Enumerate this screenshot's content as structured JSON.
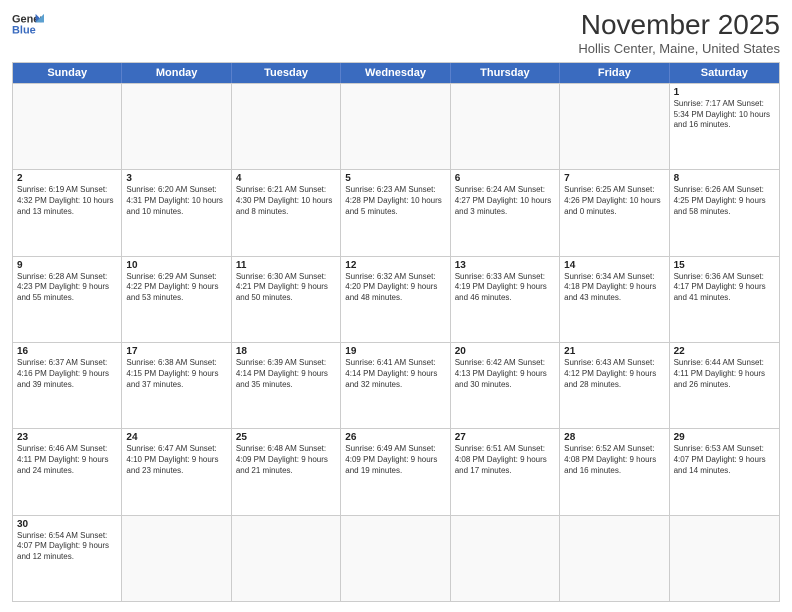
{
  "header": {
    "logo_line1": "General",
    "logo_line2": "Blue",
    "month_title": "November 2025",
    "location": "Hollis Center, Maine, United States"
  },
  "day_headers": [
    "Sunday",
    "Monday",
    "Tuesday",
    "Wednesday",
    "Thursday",
    "Friday",
    "Saturday"
  ],
  "weeks": [
    [
      {
        "day": "",
        "info": ""
      },
      {
        "day": "",
        "info": ""
      },
      {
        "day": "",
        "info": ""
      },
      {
        "day": "",
        "info": ""
      },
      {
        "day": "",
        "info": ""
      },
      {
        "day": "",
        "info": ""
      },
      {
        "day": "1",
        "info": "Sunrise: 7:17 AM\nSunset: 5:34 PM\nDaylight: 10 hours\nand 16 minutes."
      }
    ],
    [
      {
        "day": "2",
        "info": "Sunrise: 6:19 AM\nSunset: 4:32 PM\nDaylight: 10 hours\nand 13 minutes."
      },
      {
        "day": "3",
        "info": "Sunrise: 6:20 AM\nSunset: 4:31 PM\nDaylight: 10 hours\nand 10 minutes."
      },
      {
        "day": "4",
        "info": "Sunrise: 6:21 AM\nSunset: 4:30 PM\nDaylight: 10 hours\nand 8 minutes."
      },
      {
        "day": "5",
        "info": "Sunrise: 6:23 AM\nSunset: 4:28 PM\nDaylight: 10 hours\nand 5 minutes."
      },
      {
        "day": "6",
        "info": "Sunrise: 6:24 AM\nSunset: 4:27 PM\nDaylight: 10 hours\nand 3 minutes."
      },
      {
        "day": "7",
        "info": "Sunrise: 6:25 AM\nSunset: 4:26 PM\nDaylight: 10 hours\nand 0 minutes."
      },
      {
        "day": "8",
        "info": "Sunrise: 6:26 AM\nSunset: 4:25 PM\nDaylight: 9 hours\nand 58 minutes."
      }
    ],
    [
      {
        "day": "9",
        "info": "Sunrise: 6:28 AM\nSunset: 4:23 PM\nDaylight: 9 hours\nand 55 minutes."
      },
      {
        "day": "10",
        "info": "Sunrise: 6:29 AM\nSunset: 4:22 PM\nDaylight: 9 hours\nand 53 minutes."
      },
      {
        "day": "11",
        "info": "Sunrise: 6:30 AM\nSunset: 4:21 PM\nDaylight: 9 hours\nand 50 minutes."
      },
      {
        "day": "12",
        "info": "Sunrise: 6:32 AM\nSunset: 4:20 PM\nDaylight: 9 hours\nand 48 minutes."
      },
      {
        "day": "13",
        "info": "Sunrise: 6:33 AM\nSunset: 4:19 PM\nDaylight: 9 hours\nand 46 minutes."
      },
      {
        "day": "14",
        "info": "Sunrise: 6:34 AM\nSunset: 4:18 PM\nDaylight: 9 hours\nand 43 minutes."
      },
      {
        "day": "15",
        "info": "Sunrise: 6:36 AM\nSunset: 4:17 PM\nDaylight: 9 hours\nand 41 minutes."
      }
    ],
    [
      {
        "day": "16",
        "info": "Sunrise: 6:37 AM\nSunset: 4:16 PM\nDaylight: 9 hours\nand 39 minutes."
      },
      {
        "day": "17",
        "info": "Sunrise: 6:38 AM\nSunset: 4:15 PM\nDaylight: 9 hours\nand 37 minutes."
      },
      {
        "day": "18",
        "info": "Sunrise: 6:39 AM\nSunset: 4:14 PM\nDaylight: 9 hours\nand 35 minutes."
      },
      {
        "day": "19",
        "info": "Sunrise: 6:41 AM\nSunset: 4:14 PM\nDaylight: 9 hours\nand 32 minutes."
      },
      {
        "day": "20",
        "info": "Sunrise: 6:42 AM\nSunset: 4:13 PM\nDaylight: 9 hours\nand 30 minutes."
      },
      {
        "day": "21",
        "info": "Sunrise: 6:43 AM\nSunset: 4:12 PM\nDaylight: 9 hours\nand 28 minutes."
      },
      {
        "day": "22",
        "info": "Sunrise: 6:44 AM\nSunset: 4:11 PM\nDaylight: 9 hours\nand 26 minutes."
      }
    ],
    [
      {
        "day": "23",
        "info": "Sunrise: 6:46 AM\nSunset: 4:11 PM\nDaylight: 9 hours\nand 24 minutes."
      },
      {
        "day": "24",
        "info": "Sunrise: 6:47 AM\nSunset: 4:10 PM\nDaylight: 9 hours\nand 23 minutes."
      },
      {
        "day": "25",
        "info": "Sunrise: 6:48 AM\nSunset: 4:09 PM\nDaylight: 9 hours\nand 21 minutes."
      },
      {
        "day": "26",
        "info": "Sunrise: 6:49 AM\nSunset: 4:09 PM\nDaylight: 9 hours\nand 19 minutes."
      },
      {
        "day": "27",
        "info": "Sunrise: 6:51 AM\nSunset: 4:08 PM\nDaylight: 9 hours\nand 17 minutes."
      },
      {
        "day": "28",
        "info": "Sunrise: 6:52 AM\nSunset: 4:08 PM\nDaylight: 9 hours\nand 16 minutes."
      },
      {
        "day": "29",
        "info": "Sunrise: 6:53 AM\nSunset: 4:07 PM\nDaylight: 9 hours\nand 14 minutes."
      }
    ],
    [
      {
        "day": "30",
        "info": "Sunrise: 6:54 AM\nSunset: 4:07 PM\nDaylight: 9 hours\nand 12 minutes."
      },
      {
        "day": "",
        "info": ""
      },
      {
        "day": "",
        "info": ""
      },
      {
        "day": "",
        "info": ""
      },
      {
        "day": "",
        "info": ""
      },
      {
        "day": "",
        "info": ""
      },
      {
        "day": "",
        "info": ""
      }
    ]
  ]
}
